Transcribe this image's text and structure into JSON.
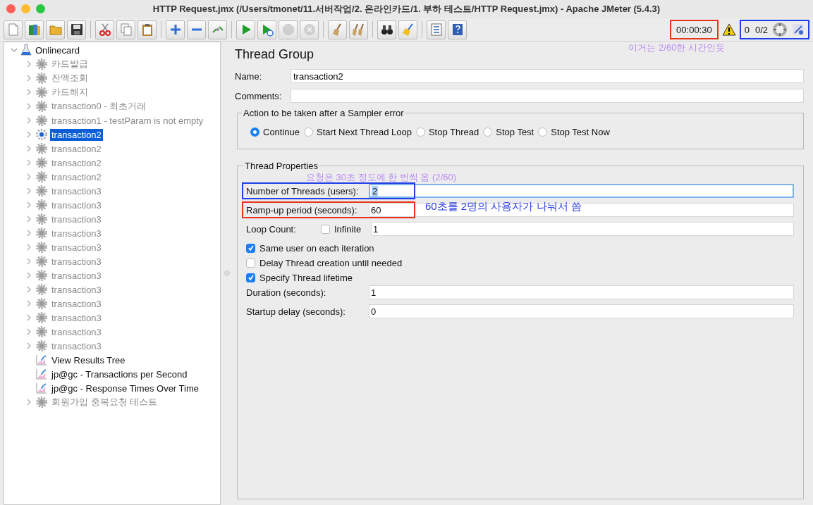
{
  "window": {
    "title": "HTTP Request.jmx (/Users/tmonet/11.서버작업/2. 온라인카드/1. 부하 테스트/HTTP Request.jmx) - Apache JMeter (5.4.3)"
  },
  "toolbar": {
    "groups": [
      [
        {
          "kind": "new",
          "disabled": false
        },
        {
          "kind": "templates",
          "disabled": false
        },
        {
          "kind": "open",
          "disabled": false
        },
        {
          "kind": "save",
          "disabled": false
        }
      ],
      [
        {
          "kind": "cut",
          "disabled": false
        },
        {
          "kind": "copy",
          "disabled": false
        },
        {
          "kind": "paste",
          "disabled": false
        }
      ],
      [
        {
          "kind": "expand",
          "disabled": false
        },
        {
          "kind": "collapse",
          "disabled": false
        },
        {
          "kind": "toggle",
          "disabled": false
        }
      ],
      [
        {
          "kind": "start",
          "disabled": false
        },
        {
          "kind": "start-no-pause",
          "disabled": false
        },
        {
          "kind": "stop",
          "disabled": true
        },
        {
          "kind": "shutdown",
          "disabled": true
        }
      ],
      [
        {
          "kind": "clear",
          "disabled": false
        },
        {
          "kind": "clear-all",
          "disabled": false
        }
      ],
      [
        {
          "kind": "search",
          "disabled": false
        },
        {
          "kind": "reset-search",
          "disabled": false
        }
      ],
      [
        {
          "kind": "function",
          "disabled": false
        },
        {
          "kind": "help",
          "disabled": false
        }
      ]
    ]
  },
  "status": {
    "groups": [
      {
        "color": "#e8331f",
        "items": [
          {
            "kind": "timer",
            "text": "00:00:30"
          }
        ]
      },
      {
        "color": "#1f3fe8",
        "items": [
          {
            "kind": "errors",
            "text": "0"
          },
          {
            "kind": "threads",
            "text": "0/2"
          },
          {
            "kind": "activity"
          },
          {
            "kind": "remote"
          }
        ]
      }
    ],
    "warning": true,
    "note": {
      "text": "이거는 2/60한 시간인듯",
      "color": "#b98cf2"
    }
  },
  "tree": {
    "label": "Onlinecard",
    "kind": "test-plan",
    "expanded": true,
    "selected": false,
    "disabled": false,
    "children": [
      {
        "label": "카드발급",
        "kind": "thread-group",
        "expanded": false,
        "selected": false,
        "disabled": true
      },
      {
        "label": "잔액조회",
        "kind": "thread-group",
        "expanded": false,
        "selected": false,
        "disabled": true
      },
      {
        "label": "카드해지",
        "kind": "thread-group",
        "expanded": false,
        "selected": false,
        "disabled": true
      },
      {
        "label": "transaction0 - 최초거래",
        "kind": "thread-group",
        "expanded": false,
        "selected": false,
        "disabled": true
      },
      {
        "label": "transaction1 - testParam is not empty",
        "kind": "thread-group",
        "expanded": false,
        "selected": false,
        "disabled": true
      },
      {
        "label": "transaction2",
        "kind": "thread-group",
        "expanded": false,
        "selected": true,
        "disabled": false
      },
      {
        "label": "transaction2",
        "kind": "thread-group",
        "expanded": false,
        "selected": false,
        "disabled": true
      },
      {
        "label": "transaction2",
        "kind": "thread-group",
        "expanded": false,
        "selected": false,
        "disabled": true
      },
      {
        "label": "transaction2",
        "kind": "thread-group",
        "expanded": false,
        "selected": false,
        "disabled": true
      },
      {
        "label": "transaction3",
        "kind": "thread-group",
        "expanded": false,
        "selected": false,
        "disabled": true
      },
      {
        "label": "transaction3",
        "kind": "thread-group",
        "expanded": false,
        "selected": false,
        "disabled": true
      },
      {
        "label": "transaction3",
        "kind": "thread-group",
        "expanded": false,
        "selected": false,
        "disabled": true
      },
      {
        "label": "transaction3",
        "kind": "thread-group",
        "expanded": false,
        "selected": false,
        "disabled": true
      },
      {
        "label": "transaction3",
        "kind": "thread-group",
        "expanded": false,
        "selected": false,
        "disabled": true
      },
      {
        "label": "transaction3",
        "kind": "thread-group",
        "expanded": false,
        "selected": false,
        "disabled": true
      },
      {
        "label": "transaction3",
        "kind": "thread-group",
        "expanded": false,
        "selected": false,
        "disabled": true
      },
      {
        "label": "transaction3",
        "kind": "thread-group",
        "expanded": false,
        "selected": false,
        "disabled": true
      },
      {
        "label": "transaction3",
        "kind": "thread-group",
        "expanded": false,
        "selected": false,
        "disabled": true
      },
      {
        "label": "transaction3",
        "kind": "thread-group",
        "expanded": false,
        "selected": false,
        "disabled": true
      },
      {
        "label": "transaction3",
        "kind": "thread-group",
        "expanded": false,
        "selected": false,
        "disabled": true
      },
      {
        "label": "transaction3",
        "kind": "thread-group",
        "expanded": false,
        "selected": false,
        "disabled": true
      },
      {
        "label": "View Results Tree",
        "kind": "listener",
        "selected": false,
        "disabled": false
      },
      {
        "label": "jp@gc - Transactions per Second",
        "kind": "listener",
        "selected": false,
        "disabled": false
      },
      {
        "label": "jp@gc - Response Times Over Time",
        "kind": "listener",
        "selected": false,
        "disabled": false
      },
      {
        "label": "회원가입 중복요청 테스트",
        "kind": "thread-group",
        "expanded": false,
        "selected": false,
        "disabled": true
      }
    ]
  },
  "panel": {
    "title": "Thread Group",
    "name": {
      "label": "Name:",
      "value": "transaction2"
    },
    "comments": {
      "label": "Comments:"
    },
    "on_error": {
      "legend": "Action to be taken after a Sampler error",
      "options": [
        {
          "label": "Continue",
          "selected": true
        },
        {
          "label": "Start Next Thread Loop",
          "selected": false
        },
        {
          "label": "Stop Thread",
          "selected": false
        },
        {
          "label": "Stop Test",
          "selected": false
        },
        {
          "label": "Stop Test Now",
          "selected": false
        }
      ]
    },
    "thread_properties": {
      "legend": "Thread Properties",
      "rows": [
        {
          "kind": "field",
          "label": "Number of Threads (users):",
          "value": "2",
          "focused": true,
          "color": "#1f3fe8",
          "note": {
            "text": "요청은 30초 정도에 한 번씩 옴 (2/60)",
            "color": "#b98cf2"
          }
        },
        {
          "kind": "field",
          "label": "Ramp-up period (seconds):",
          "value": "60",
          "focused": false,
          "color": "#e8331f",
          "note": {
            "text": "60초를 2명의 사용자가 나눠서 씀",
            "color": "#2c3ee6"
          }
        },
        {
          "kind": "loop",
          "label": "Loop Count:",
          "checkbox_label": "Infinite",
          "checked": false,
          "value": "1"
        },
        {
          "kind": "check",
          "label": "Same user on each iteration",
          "checked": true
        },
        {
          "kind": "check",
          "label": "Delay Thread creation until needed",
          "checked": false
        },
        {
          "kind": "check",
          "label": "Specify Thread lifetime",
          "checked": true
        },
        {
          "kind": "field",
          "label": "Duration (seconds):",
          "value": "1",
          "focused": false
        },
        {
          "kind": "field",
          "label": "Startup delay (seconds):",
          "value": "0",
          "focused": false
        }
      ]
    }
  }
}
